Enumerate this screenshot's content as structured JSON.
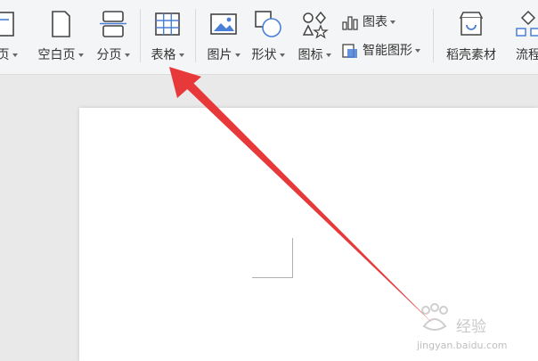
{
  "toolbar": {
    "items": [
      {
        "label": "页",
        "icon": "page-icon"
      },
      {
        "label": "空白页",
        "icon": "blank-page-icon"
      },
      {
        "label": "分页",
        "icon": "page-break-icon"
      },
      {
        "label": "表格",
        "icon": "table-icon"
      },
      {
        "label": "图片",
        "icon": "picture-icon"
      },
      {
        "label": "形状",
        "icon": "shape-icon"
      },
      {
        "label": "图标",
        "icon": "icons-icon"
      },
      {
        "label": "稻壳素材",
        "icon": "docer-material-icon"
      },
      {
        "label": "流程",
        "icon": "flowchart-icon"
      }
    ],
    "chart_label": "图表",
    "smartart_label": "智能图形"
  },
  "watermark": {
    "logo_text": "经验",
    "url": "jingyan.baidu.com"
  },
  "colors": {
    "accent": "#4a7fd6",
    "arrow": "#e8393a",
    "ribbon_bg": "#f4f5f6"
  }
}
